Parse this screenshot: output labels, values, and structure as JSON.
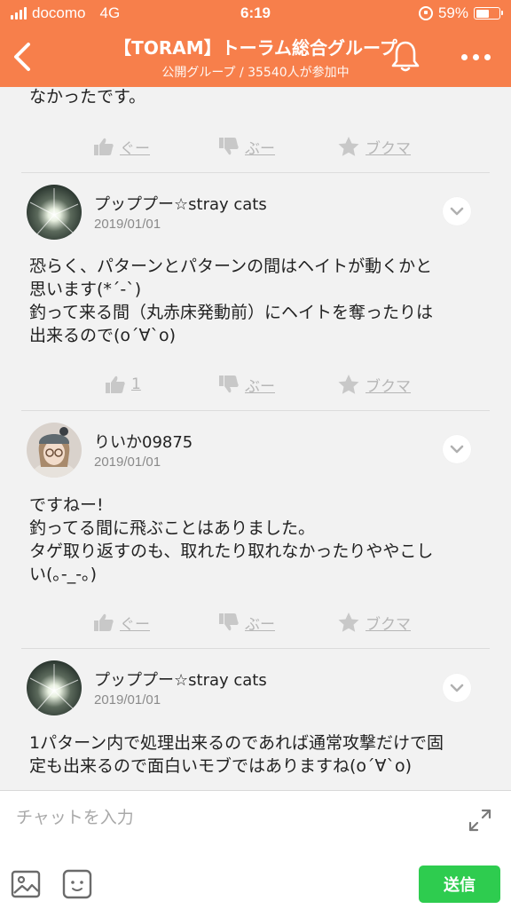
{
  "status_bar": {
    "carrier": "docomo",
    "network": "4G",
    "time": "6:19",
    "battery": "59%",
    "battery_level": 0.59
  },
  "header": {
    "title": "【TORAM】トーラム総合グループ",
    "subtitle": "公開グループ / 35540人が参加中",
    "icons": [
      "back-arrow-icon",
      "bell-icon",
      "more-icon"
    ],
    "color": "#f77f4b"
  },
  "posts": [
    {
      "partial": true,
      "body": [
        "なかったです。"
      ],
      "like": "ぐー",
      "boo": "ぶー",
      "bookmark": "ブクマ"
    },
    {
      "user": "プッププー☆stray cats",
      "date": "2019/01/01",
      "body": [
        "恐らく、パターンとパターンの間はヘイトが動くかと",
        "思います(*´-`)",
        "釣って来る間（丸赤床発動前）にヘイトを奪ったりは",
        "出来るので(o´∀`o)"
      ],
      "like": "1",
      "boo": "ぶー",
      "bookmark": "ブクマ"
    },
    {
      "user": "りいか09875",
      "date": "2019/01/01",
      "body": [
        "ですねー!",
        "釣ってる間に飛ぶことはありました。",
        "タゲ取り返すのも、取れたり取れなかったりややこし",
        "い(｡-_-｡)"
      ],
      "like": "ぐー",
      "boo": "ぶー",
      "bookmark": "ブクマ"
    },
    {
      "user": "プッププー☆stray cats",
      "date": "2019/01/01",
      "body": [
        "1パターン内で処理出来るのであれば通常攻撃だけで固",
        "定も出来るので面白いモブではありますね(o´∀`o)"
      ]
    }
  ],
  "composer": {
    "placeholder": "チャットを入力",
    "send_label": "送信",
    "send_color": "#2ecc4f"
  }
}
